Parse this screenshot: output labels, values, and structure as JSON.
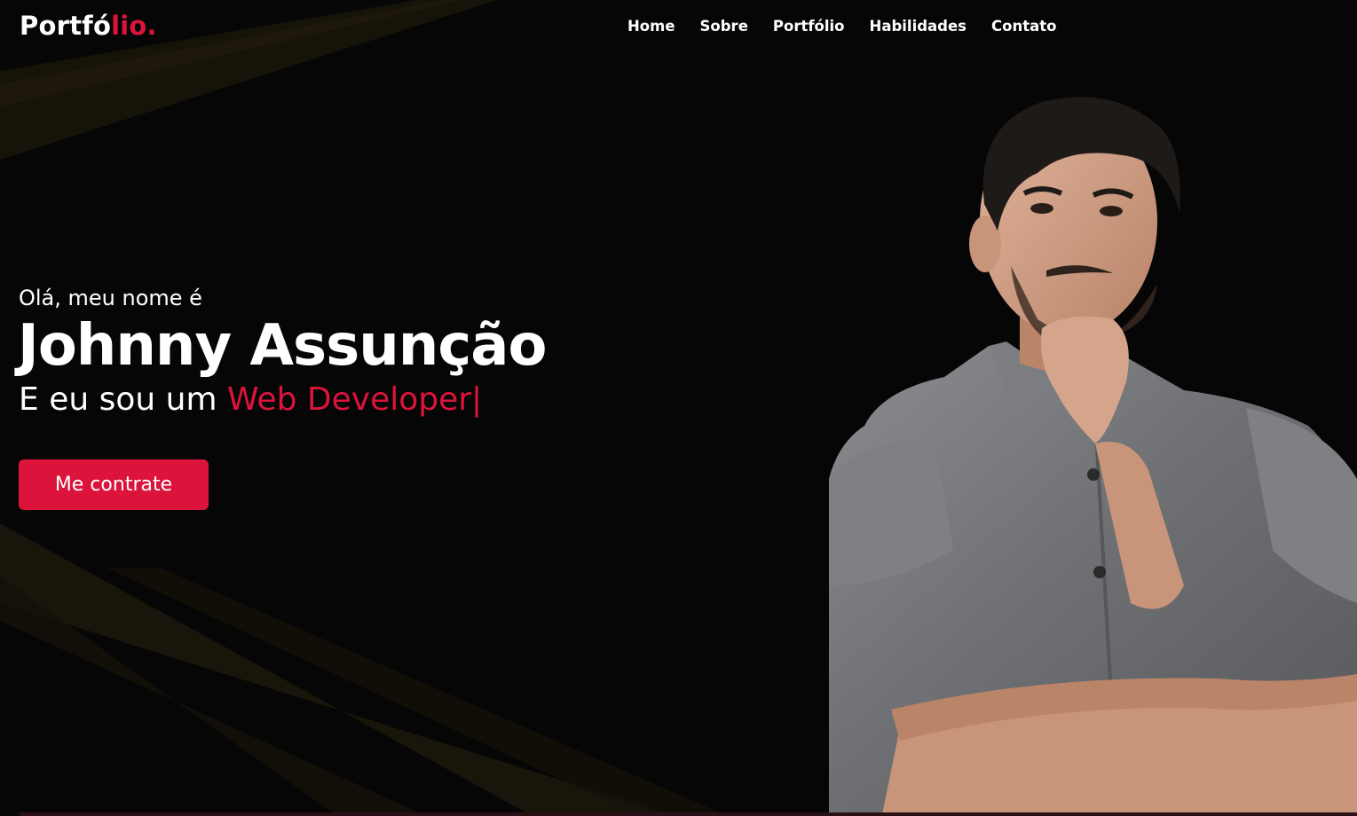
{
  "navbar": {
    "logo_main": "Portfó",
    "logo_accent": "lio.",
    "items": [
      {
        "label": "Home"
      },
      {
        "label": "Sobre"
      },
      {
        "label": "Portfólio"
      },
      {
        "label": "Habilidades"
      },
      {
        "label": "Contato"
      }
    ]
  },
  "hero": {
    "greeting": "Olá, meu nome é",
    "name": "Johnny Assunção",
    "role_prefix": "E eu sou um ",
    "role_typed": "Web Developer|",
    "cta_label": "Me contrate"
  },
  "colors": {
    "accent": "#dc143c",
    "background": "#060606",
    "text": "#ffffff"
  },
  "icons": [
    "portrait-photo"
  ]
}
